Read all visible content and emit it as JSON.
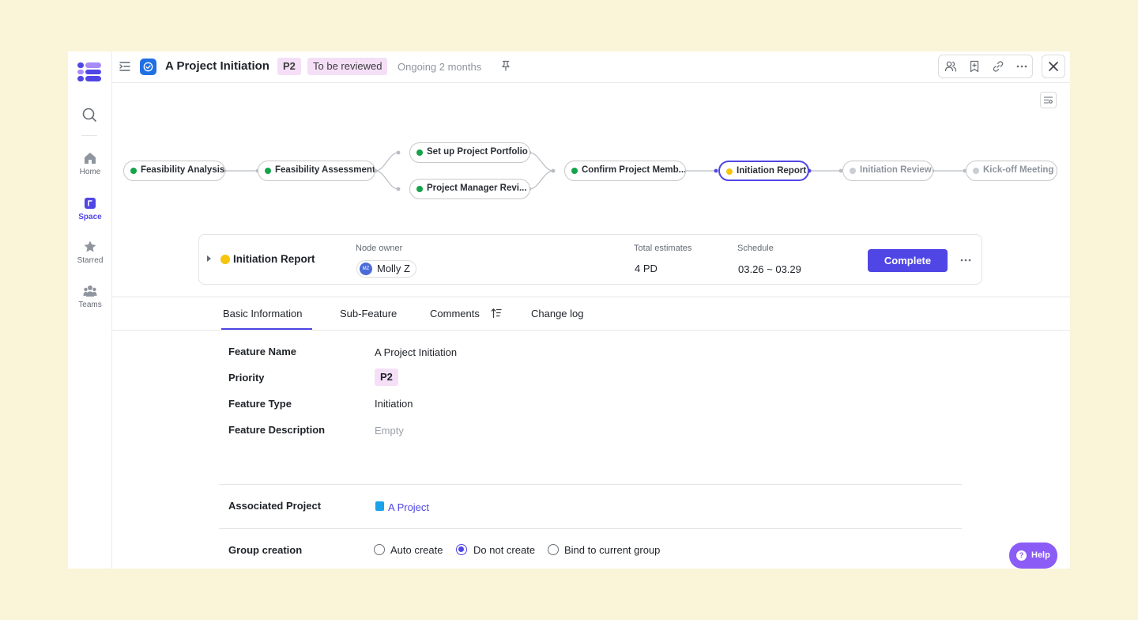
{
  "header": {
    "title": "A Project Initiation",
    "priority": "P2",
    "status": "To be reviewed",
    "ongoing": "Ongoing 2 months"
  },
  "sidebar": {
    "items": [
      {
        "label": "Home",
        "icon": "home-icon"
      },
      {
        "label": "Space",
        "icon": "space-icon",
        "active": true
      },
      {
        "label": "Starred",
        "icon": "star-icon"
      },
      {
        "label": "Teams",
        "icon": "teams-icon"
      }
    ]
  },
  "workflow": {
    "nodes": [
      {
        "label": "Feasibility Analysis",
        "state": "done"
      },
      {
        "label": "Feasibility Assessment",
        "state": "done"
      },
      {
        "label": "Set up Project Portfolio",
        "state": "done"
      },
      {
        "label": "Project Manager Revi...",
        "state": "done"
      },
      {
        "label": "Confirm Project Memb...",
        "state": "done"
      },
      {
        "label": "Initiation Report",
        "state": "active"
      },
      {
        "label": "Initiation Review",
        "state": "pending"
      },
      {
        "label": "Kick-off Meeting",
        "state": "pending"
      }
    ],
    "colors": {
      "done": "#16a34a",
      "active": "#f7c50e",
      "pending": "#c9cdd4",
      "accent": "#4f46e5"
    }
  },
  "node_card": {
    "title": "Initiation Report",
    "owner_label": "Node owner",
    "owner_initials": "MZ",
    "owner_name": "Molly Z",
    "estimate_label": "Total estimates",
    "estimate_value": "4 PD",
    "schedule_label": "Schedule",
    "schedule_value": "03.26 ~ 03.29",
    "complete_button": "Complete"
  },
  "tabs": [
    "Basic Information",
    "Sub-Feature",
    "Comments",
    "Change log"
  ],
  "details": {
    "feature_name_label": "Feature Name",
    "feature_name": "A Project Initiation",
    "priority_label": "Priority",
    "priority": "P2",
    "feature_type_label": "Feature Type",
    "feature_type": "Initiation",
    "description_label": "Feature Description",
    "description": "Empty",
    "associated_project_label": "Associated Project",
    "associated_project": "A Project",
    "group_creation_label": "Group creation",
    "group_options": [
      "Auto create",
      "Do not create",
      "Bind to current group"
    ],
    "group_selected": "Do not create"
  },
  "help": {
    "label": "Help"
  }
}
